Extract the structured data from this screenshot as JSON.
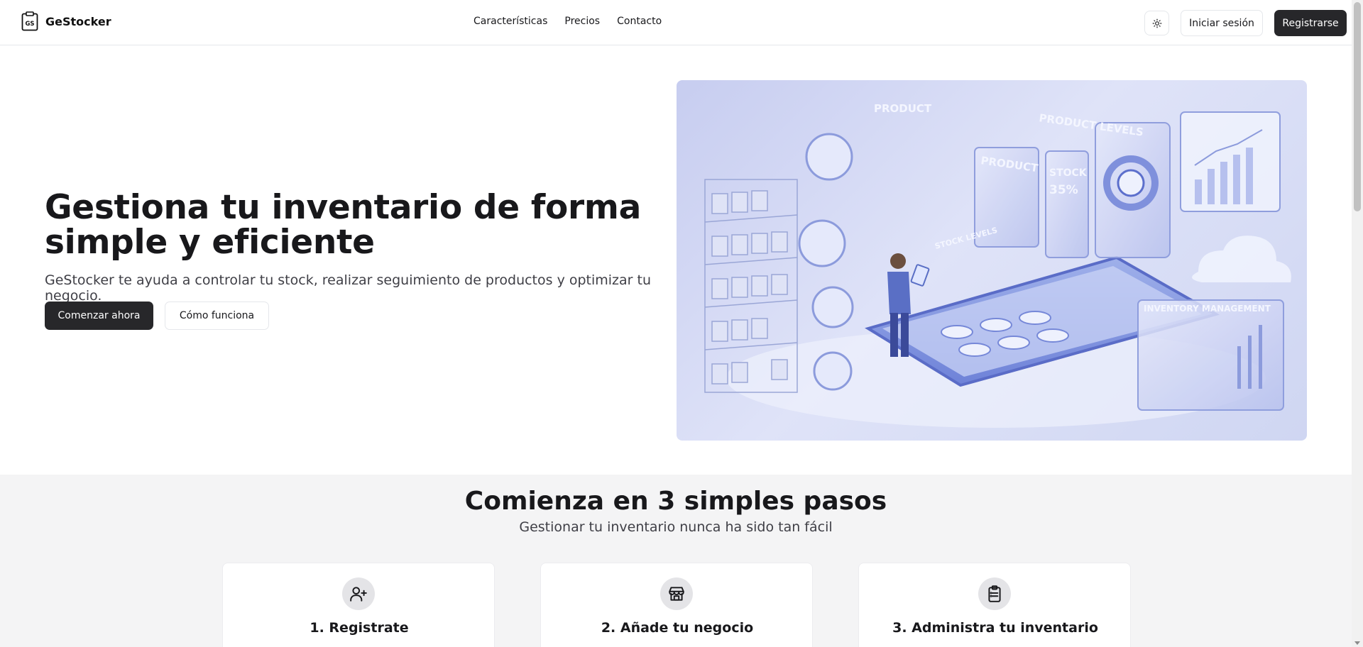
{
  "header": {
    "brand": {
      "logo_text": "GS",
      "name": "GeStocker"
    },
    "nav": [
      "Características",
      "Precios",
      "Contacto"
    ],
    "theme_icon": "sun-icon",
    "login_label": "Iniciar sesión",
    "register_label": "Registrarse"
  },
  "hero": {
    "title": "Gestiona tu inventario de forma simple y eficiente",
    "subtitle": "GeStocker te ayuda a controlar tu stock, realizar seguimiento de productos y optimizar tu negocio.",
    "cta_primary": "Comenzar ahora",
    "cta_secondary": "Cómo funciona",
    "image": {
      "labels": [
        "PRODUCT",
        "PRODUCT LEVELS",
        "PRODUCT",
        "STOCK",
        "35%",
        "STOCK LEVELS",
        "INVENTORY MANAGEMENT"
      ]
    }
  },
  "steps": {
    "title": "Comienza en 3 simples pasos",
    "subtitle": "Gestionar tu inventario nunca ha sido tan fácil",
    "cards": [
      {
        "icon": "user-plus-icon",
        "title": "1. Registrate"
      },
      {
        "icon": "store-icon",
        "title": "2. Añade tu negocio"
      },
      {
        "icon": "clipboard-list-icon",
        "title": "3. Administra tu inventario"
      }
    ]
  },
  "colors": {
    "primary": "#27272a",
    "section_bg": "#f4f4f5",
    "hero_image_tint": "#c7cdf0"
  }
}
